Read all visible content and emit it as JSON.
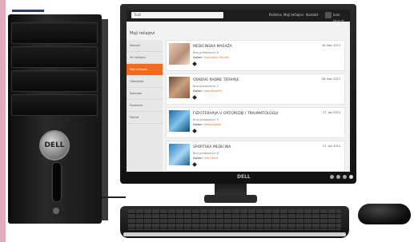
{
  "screen": {
    "search_placeholder": "Traži",
    "topbar_links": [
      "Početna",
      "Moji tečajevi",
      "Kontakt"
    ],
    "user_label": "Ivan Horvat",
    "page_title": "Moji tečajevi",
    "sidebar": [
      "Novosti",
      "Svi tečajevi",
      "Moji tečajevi",
      "Obavijesti",
      "Kalendar",
      "Postavke",
      "Pomoć"
    ],
    "active_index": 2,
    "courses": [
      {
        "title": "MEDICINSKA MASAŽA",
        "date": "26. Nov 2013",
        "lessons": "Broj predavanja: 6",
        "author_prefix": "Autor:",
        "author": "Anamarija Horvat"
      },
      {
        "title": "OSNOVE RADNE TERAPIJE",
        "date": "26. Nov 2013",
        "lessons": "Broj predavanja: 2",
        "author_prefix": "Autor:",
        "author": "Josip Kovačić"
      },
      {
        "title": "FIZIOTERAPIJA U ORTOPEDIJI I TRAUMATOLOGIJI",
        "date": "27. Jan 2014",
        "lessons": "Broj predavanja: 5",
        "author_prefix": "Autor:",
        "author": "Marko Babić"
      },
      {
        "title": "SPORTSKA MEDICINA",
        "date": "22. Jan 2014",
        "lessons": "Broj predavanja: 8",
        "author_prefix": "Autor:",
        "author": "Ivan Marić"
      }
    ]
  },
  "hardware": {
    "tower_logo": "DELL",
    "monitor_logo": "DELL"
  },
  "colors": {
    "accent": "#ef6b22",
    "sidebar": "#e7e7e7",
    "topbar": "#1e1e1e"
  }
}
